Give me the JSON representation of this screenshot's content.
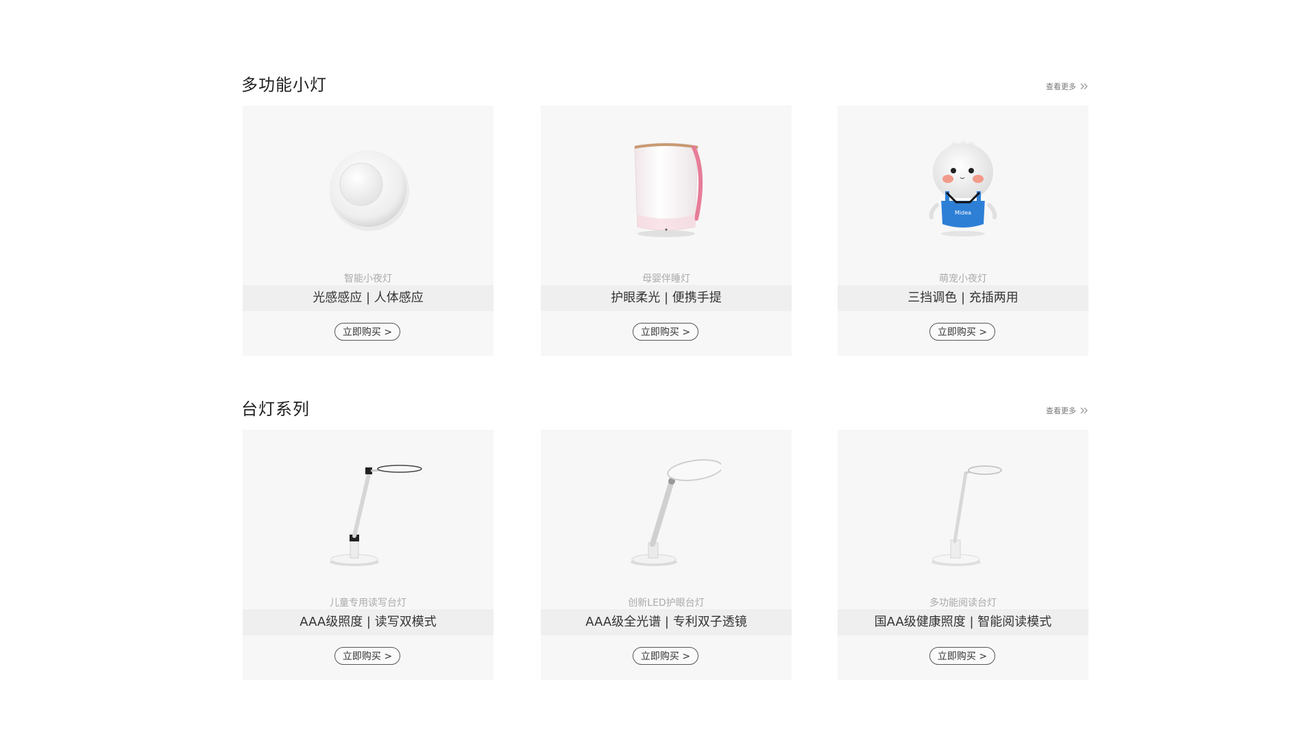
{
  "sections": [
    {
      "title": "多功能小灯",
      "more_label": "查看更多",
      "products": [
        {
          "category": "智能小夜灯",
          "features": "光感感应 | 人体感应",
          "buy_label": "立即购买 >"
        },
        {
          "category": "母婴伴睡灯",
          "features": "护眼柔光 | 便携手提",
          "buy_label": "立即购买 >"
        },
        {
          "category": "萌宠小夜灯",
          "features": "三挡调色 | 充插两用",
          "buy_label": "立即购买 >"
        }
      ]
    },
    {
      "title": "台灯系列",
      "more_label": "查看更多",
      "products": [
        {
          "category": "儿童专用读写台灯",
          "features": "AAA级照度 | 读写双模式",
          "buy_label": "立即购买 >"
        },
        {
          "category": "创新LED护眼台灯",
          "features": "AAA级全光谱 | 专利双子透镜",
          "buy_label": "立即购买 >"
        },
        {
          "category": "多功能阅读台灯",
          "features": "国AA级健康照度 | 智能阅读模式",
          "buy_label": "立即购买 >"
        }
      ]
    }
  ],
  "colors": {
    "card_background": "#f7f7f7",
    "feature_band": "#efefef",
    "category_text": "#aaaaaa",
    "button_border": "#555555"
  },
  "icons": {
    "more_arrow": "double-chevron-right-icon",
    "brand_badge": "midea-logo"
  },
  "brand_badge_text": "Midea"
}
